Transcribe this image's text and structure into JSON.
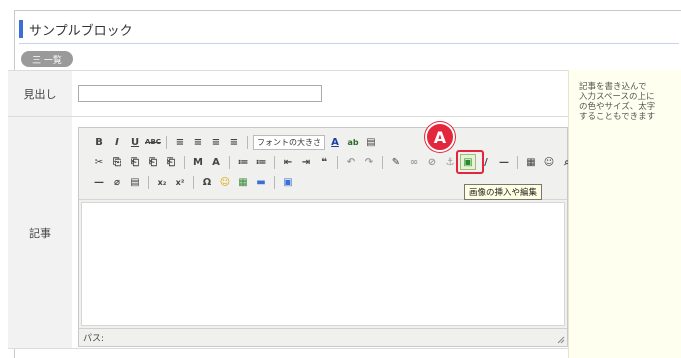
{
  "panel": {
    "title": "サンプルブロック",
    "list_button": "三 一覧"
  },
  "form": {
    "heading_label": "見出し",
    "heading_value": "",
    "body_label": "記事"
  },
  "editor": {
    "toolbar": {
      "row1": [
        "B",
        "I",
        "U",
        "ABC",
        "≡",
        "≡",
        "≡",
        "≡"
      ],
      "font_size_select": "フォントの大きさ",
      "row1_tail": [
        "A",
        "ab",
        "▤"
      ],
      "row2": [
        "✂",
        "⎘",
        "⎗",
        "⎗",
        "⎗",
        "M",
        "A",
        "≔",
        "≔",
        "⇤",
        "⇥",
        "❝",
        "↶",
        "↷",
        "✎",
        "∞",
        "⊘",
        "⚓",
        "▣",
        "/",
        "—",
        "▦",
        "☺",
        "⌕"
      ],
      "row3": [
        "—",
        "⌀",
        "▤",
        "x₂",
        "x²",
        "Ω",
        "☺",
        "▦",
        "▬",
        "▣"
      ]
    },
    "status_path": "パス:"
  },
  "help": {
    "text": "記事を書き込んで\n入力スペースの上に\nの色やサイズ、太字\nすることもできます"
  },
  "callout": {
    "label": "A",
    "tooltip": "画像の挿入や編集"
  }
}
